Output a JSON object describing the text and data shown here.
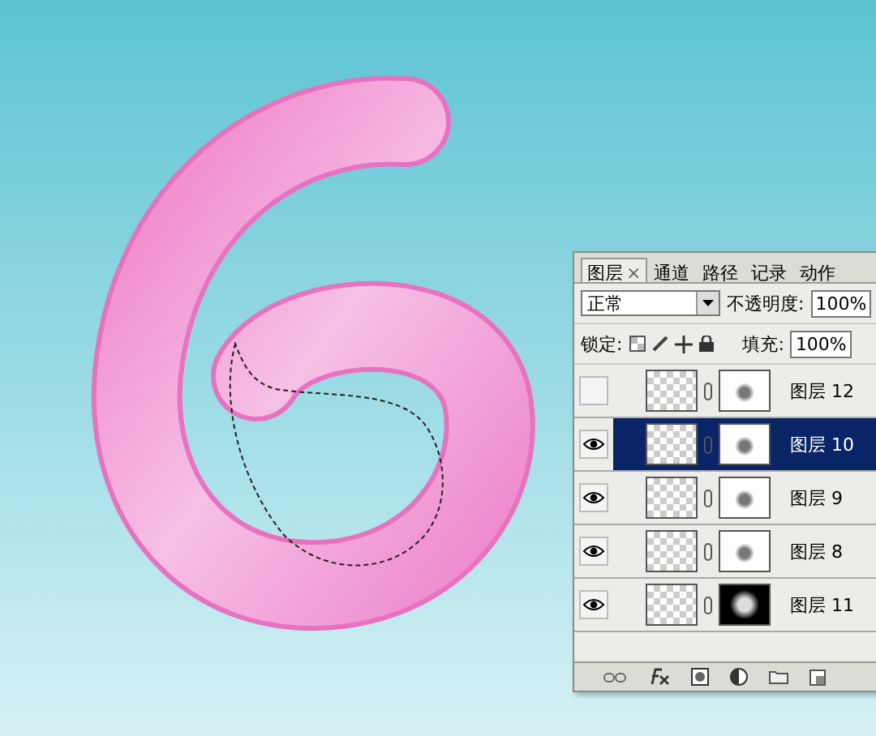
{
  "tabs": [
    {
      "label": "图层",
      "selected": true,
      "close": "×"
    },
    {
      "label": "通道",
      "selected": false
    },
    {
      "label": "路径",
      "selected": false
    },
    {
      "label": "记录",
      "selected": false
    },
    {
      "label": "动作",
      "selected": false
    }
  ],
  "blend_mode": "正常",
  "opacity_label": "不透明度:",
  "opacity": "100%",
  "lock_label": "锁定:",
  "fill_label": "填充:",
  "fill": "100%",
  "layers": [
    {
      "name": "图层 12",
      "visible": false,
      "selected": false,
      "kind": "light"
    },
    {
      "name": "图层 10",
      "visible": true,
      "selected": true,
      "kind": "light"
    },
    {
      "name": "图层 9",
      "visible": true,
      "selected": false,
      "kind": "light"
    },
    {
      "name": "图层 8",
      "visible": true,
      "selected": false,
      "kind": "light"
    },
    {
      "name": "图层 11",
      "visible": true,
      "selected": false,
      "kind": "dark"
    }
  ]
}
